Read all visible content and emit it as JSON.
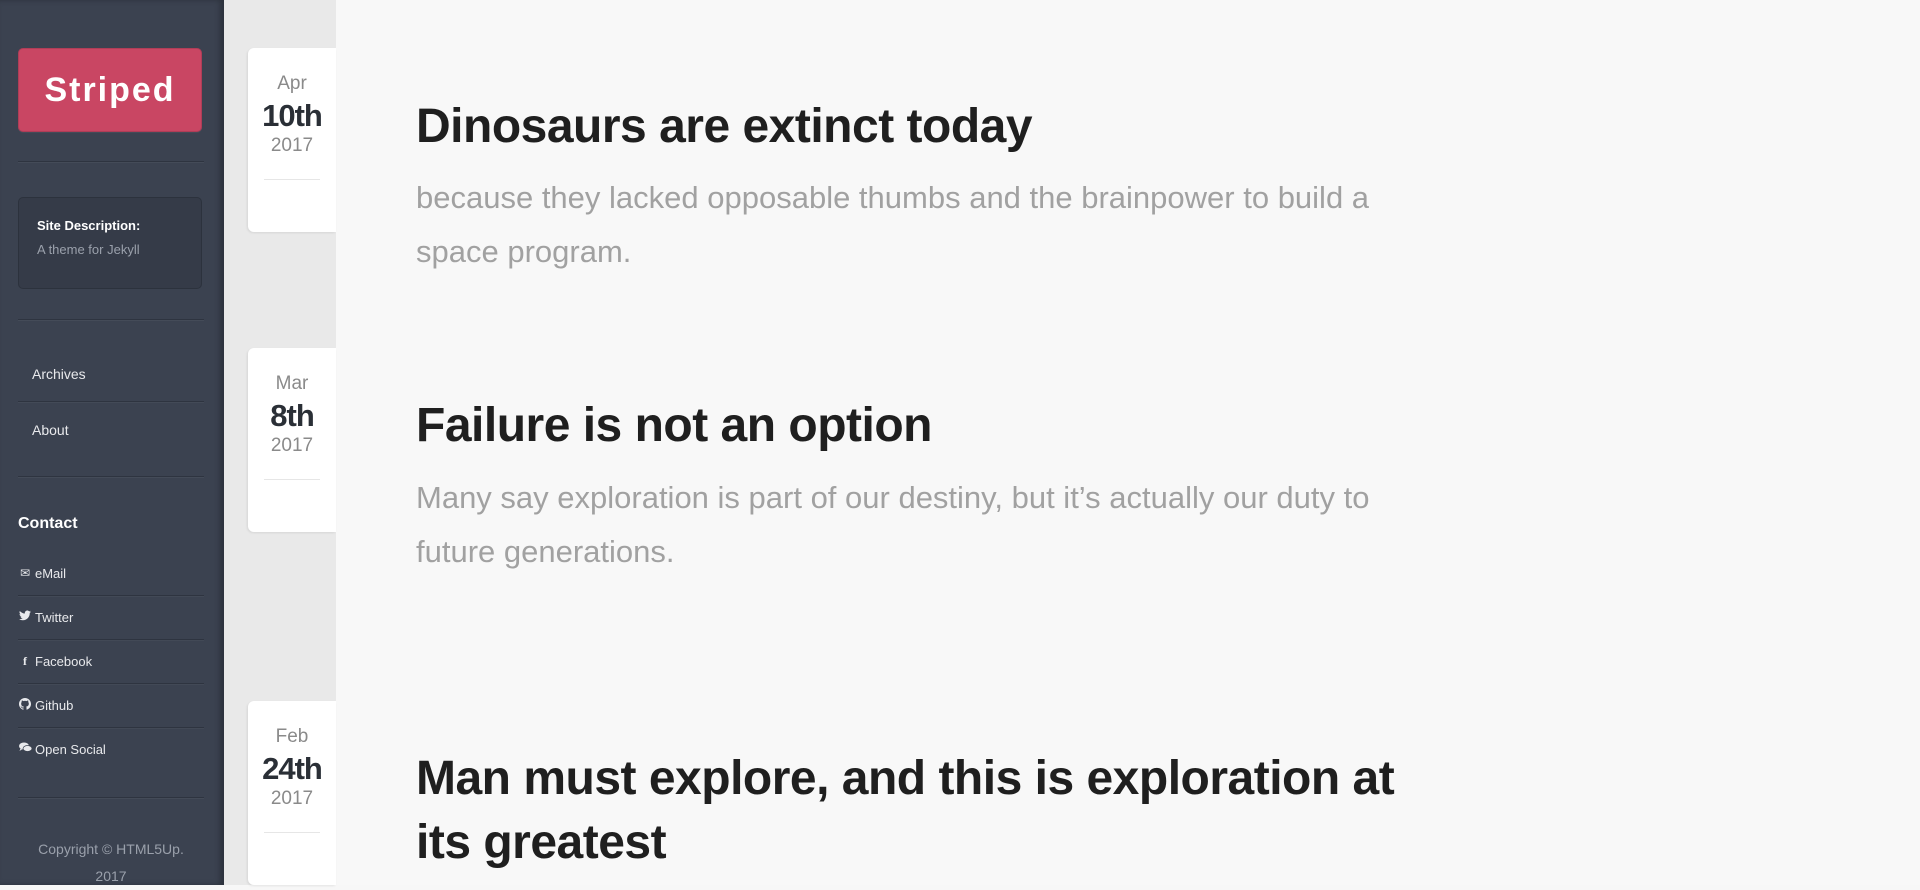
{
  "sidebar": {
    "logo": "Striped",
    "description": {
      "title": "Site Description:",
      "text": "A theme for Jekyll"
    },
    "nav": [
      {
        "label": "Archives"
      },
      {
        "label": "About"
      }
    ],
    "contact": {
      "heading": "Contact",
      "items": [
        {
          "label": "eMail",
          "icon": "envelope-icon",
          "glyph": "✉"
        },
        {
          "label": "Twitter",
          "icon": "twitter-icon",
          "glyph": "🐦"
        },
        {
          "label": "Facebook",
          "icon": "facebook-icon",
          "glyph": "f"
        },
        {
          "label": "Github",
          "icon": "github-icon",
          "glyph": "◉"
        },
        {
          "label": "Open Social",
          "icon": "chat-bubbles-icon",
          "glyph": "💬"
        }
      ]
    },
    "copyright_line1": "Copyright © HTML5Up.",
    "copyright_line2": "2017"
  },
  "posts": [
    {
      "month": "Apr",
      "day": "10th",
      "year": "2017",
      "title": "Dinosaurs are extinct today",
      "subtitle": "because they lacked opposable thumbs and the brainpower to build a space program."
    },
    {
      "month": "Mar",
      "day": "8th",
      "year": "2017",
      "title": "Failure is not an option",
      "subtitle": "Many say exploration is part of our destiny, but it’s actually our duty to future generations."
    },
    {
      "month": "Feb",
      "day": "24th",
      "year": "2017",
      "title": "Man must explore, and this is exploration at its greatest",
      "subtitle": ""
    }
  ],
  "colors": {
    "sidebar_bg": "#3b4250",
    "logo_bg": "#c94663",
    "title_text": "#1f1f1f",
    "subtitle_text": "#a1a1a1"
  }
}
